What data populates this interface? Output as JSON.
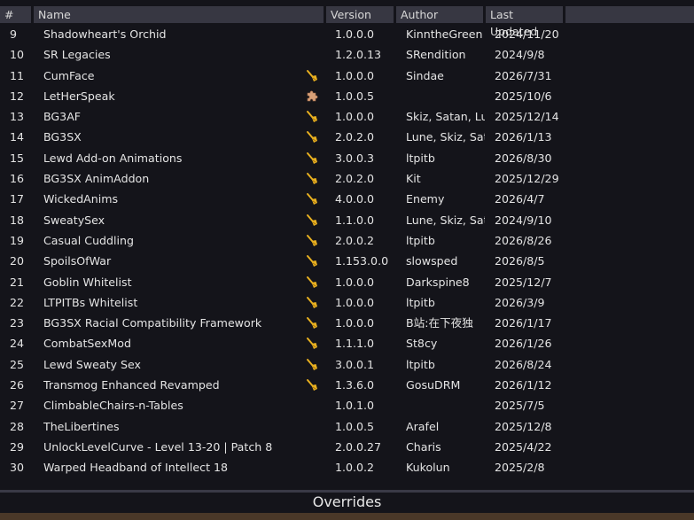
{
  "columns": {
    "num": "#",
    "name": "Name",
    "version": "Version",
    "author": "Author",
    "last_updated": "Last Updated"
  },
  "rows": [
    {
      "num": "9",
      "name": "Shadowheart's Orchid",
      "icon": "",
      "version": "1.0.0.0",
      "author": "KinntheGreen",
      "date": "2024/11/20"
    },
    {
      "num": "10",
      "name": "SR Legacies",
      "icon": "",
      "version": "1.2.0.13",
      "author": "SRendition",
      "date": "2024/9/8"
    },
    {
      "num": "11",
      "name": "CumFace",
      "icon": "broom-icon",
      "version": "1.0.0.0",
      "author": "Sindae",
      "date": "2026/7/31"
    },
    {
      "num": "12",
      "name": "LetHerSpeak",
      "icon": "puzzle-icon",
      "version": "1.0.0.5",
      "author": "",
      "date": "2025/10/6"
    },
    {
      "num": "13",
      "name": "BG3AF",
      "icon": "broom-icon",
      "version": "1.0.0.0",
      "author": "Skiz, Satan, Lune",
      "date": "2025/12/14"
    },
    {
      "num": "14",
      "name": "BG3SX",
      "icon": "broom-icon",
      "version": "2.0.2.0",
      "author": "Lune, Skiz, Satan",
      "date": "2026/1/13"
    },
    {
      "num": "15",
      "name": "Lewd Add-on Animations",
      "icon": "broom-icon",
      "version": "3.0.0.3",
      "author": "ltpitb",
      "date": "2026/8/30"
    },
    {
      "num": "16",
      "name": "BG3SX AnimAddon",
      "icon": "broom-icon",
      "version": "2.0.2.0",
      "author": "Kit",
      "date": "2025/12/29"
    },
    {
      "num": "17",
      "name": "WickedAnims",
      "icon": "broom-icon",
      "version": "4.0.0.0",
      "author": "Enemy",
      "date": "2026/4/7"
    },
    {
      "num": "18",
      "name": "SweatySex",
      "icon": "broom-icon",
      "version": "1.1.0.0",
      "author": "Lune, Skiz, Satan",
      "date": "2024/9/10"
    },
    {
      "num": "19",
      "name": "Casual Cuddling",
      "icon": "broom-icon",
      "version": "2.0.0.2",
      "author": "ltpitb",
      "date": "2026/8/26"
    },
    {
      "num": "20",
      "name": "SpoilsOfWar",
      "icon": "broom-icon",
      "version": "1.153.0.0",
      "author": "slowsped",
      "date": "2026/8/5"
    },
    {
      "num": "21",
      "name": "Goblin Whitelist",
      "icon": "broom-icon",
      "version": "1.0.0.0",
      "author": "Darkspine8",
      "date": "2025/12/7"
    },
    {
      "num": "22",
      "name": "LTPITBs Whitelist",
      "icon": "broom-icon",
      "version": "1.0.0.0",
      "author": "ltpitb",
      "date": "2026/3/9"
    },
    {
      "num": "23",
      "name": "BG3SX Racial Compatibility Framework",
      "icon": "broom-icon",
      "version": "1.0.0.0",
      "author": "B站:在下夜独",
      "date": "2026/1/17"
    },
    {
      "num": "24",
      "name": "CombatSexMod",
      "icon": "broom-icon",
      "version": "1.1.1.0",
      "author": "St8cy",
      "date": "2026/1/26"
    },
    {
      "num": "25",
      "name": "Lewd Sweaty Sex",
      "icon": "broom-icon",
      "version": "3.0.0.1",
      "author": "ltpitb",
      "date": "2026/8/24"
    },
    {
      "num": "26",
      "name": "Transmog Enhanced Revamped",
      "icon": "broom-icon",
      "version": "1.3.6.0",
      "author": "GosuDRM",
      "date": "2026/1/12"
    },
    {
      "num": "27",
      "name": "ClimbableChairs-n-Tables",
      "icon": "",
      "version": "1.0.1.0",
      "author": "",
      "date": "2025/7/5"
    },
    {
      "num": "28",
      "name": "TheLibertines",
      "icon": "",
      "version": "1.0.0.5",
      "author": "Arafel",
      "date": "2025/12/8"
    },
    {
      "num": "29",
      "name": "UnlockLevelCurve - Level 13-20 | Patch 8",
      "icon": "",
      "version": "2.0.0.27",
      "author": "Charis",
      "date": "2025/4/22"
    },
    {
      "num": "30",
      "name": "Warped Headband of Intellect 18",
      "icon": "",
      "version": "1.0.0.2",
      "author": "Kukolun",
      "date": "2025/2/8"
    }
  ],
  "overrides": {
    "title": "Overrides"
  },
  "colors": {
    "broom": "#e8b020",
    "puzzle": "#d8a078",
    "header_bg": "#373742",
    "background": "#14141a"
  }
}
